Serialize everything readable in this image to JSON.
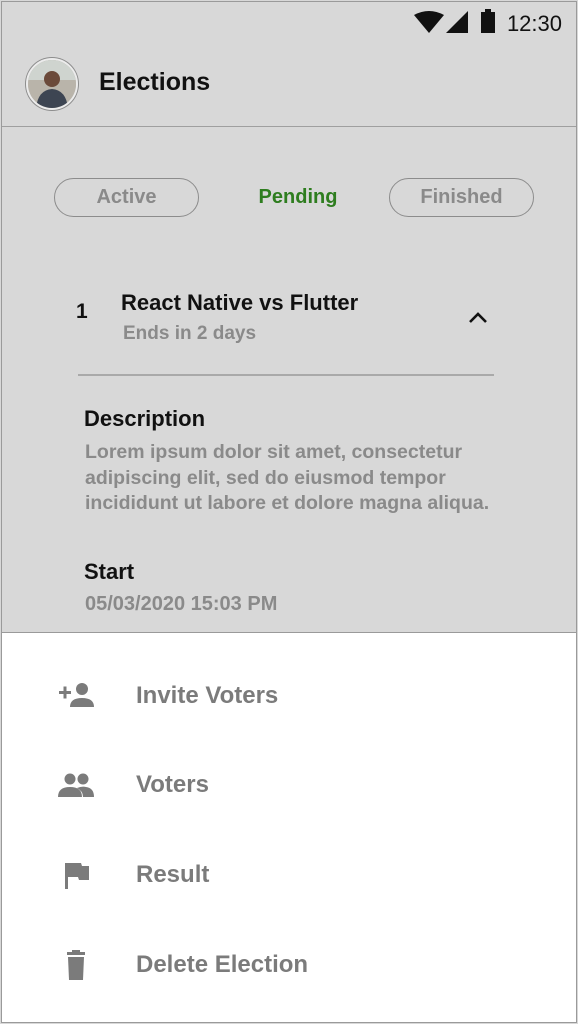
{
  "status_bar": {
    "time": "12:30",
    "icons": [
      "wifi-icon",
      "signal-icon",
      "battery-icon"
    ]
  },
  "app_bar": {
    "title": "Elections",
    "avatar": "avatar"
  },
  "tabs": [
    {
      "label": "Active"
    },
    {
      "label": "Pending",
      "selected": true
    },
    {
      "label": "Finished"
    }
  ],
  "election": {
    "number": "1",
    "title": "React Native vs Flutter",
    "subtitle": "Ends in 2 days",
    "description_label": "Description",
    "description": "Lorem ipsum dolor sit amet, consectetur adipiscing elit, sed do eiusmod tempor incididunt ut labore et dolore magna aliqua.",
    "start_label": "Start",
    "start_value": "05/03/2020 15:03 PM"
  },
  "menu": [
    {
      "label": "Invite Voters",
      "icon": "person-add-icon"
    },
    {
      "label": "Voters",
      "icon": "people-icon"
    },
    {
      "label": "Result",
      "icon": "flag-icon"
    },
    {
      "label": "Delete Election",
      "icon": "trash-icon"
    }
  ],
  "colors": {
    "accent": "#2e7d1f",
    "muted": "#8a8a8a",
    "background": "#d8d8d8",
    "sheet": "#ffffff"
  }
}
